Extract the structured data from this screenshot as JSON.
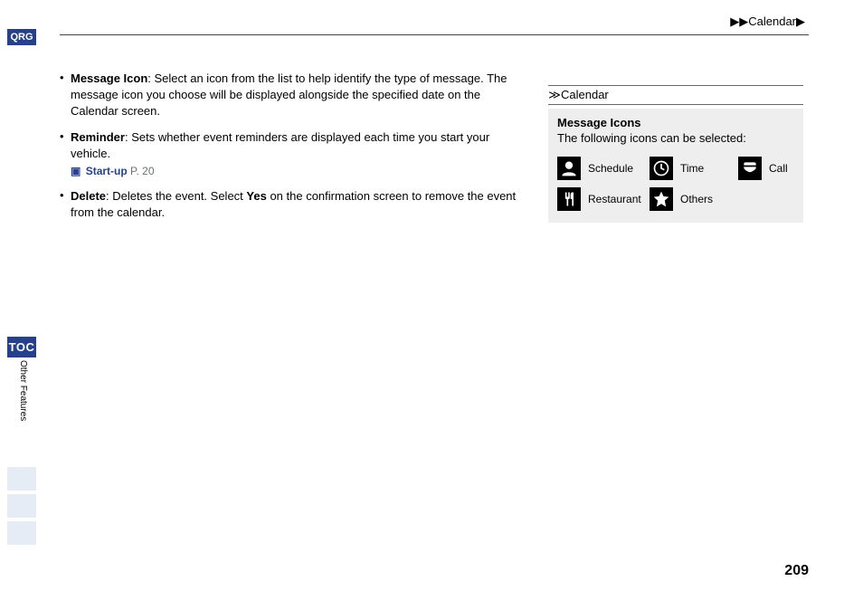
{
  "breadcrumb": "▶▶Calendar▶",
  "left_rail": {
    "qrg": "QRG",
    "toc": "TOC",
    "section": "Other Features"
  },
  "bullets": {
    "b1": {
      "term": "Message Icon",
      "text": ": Select an icon from the list to help identify the type of message. The message icon you choose will be displayed alongside the specified date on the Calendar screen."
    },
    "b2": {
      "term": "Reminder",
      "text": ": Sets whether event reminders are displayed each time you start your vehicle.",
      "xref_label": "Start-up",
      "xref_page": "P. 20"
    },
    "b3": {
      "term": "Delete",
      "text_before": ": Deletes the event. Select ",
      "yes": "Yes",
      "text_after": " on the confirmation screen to remove the event from the calendar."
    }
  },
  "sidebar": {
    "header_symbol": "≫",
    "header": "Calendar",
    "title": "Message Icons",
    "desc": "The following icons can be selected:",
    "icons": {
      "schedule": "Schedule",
      "time": "Time",
      "call": "Call",
      "restaurant": "Restaurant",
      "others": "Others"
    }
  },
  "page_number": "209"
}
